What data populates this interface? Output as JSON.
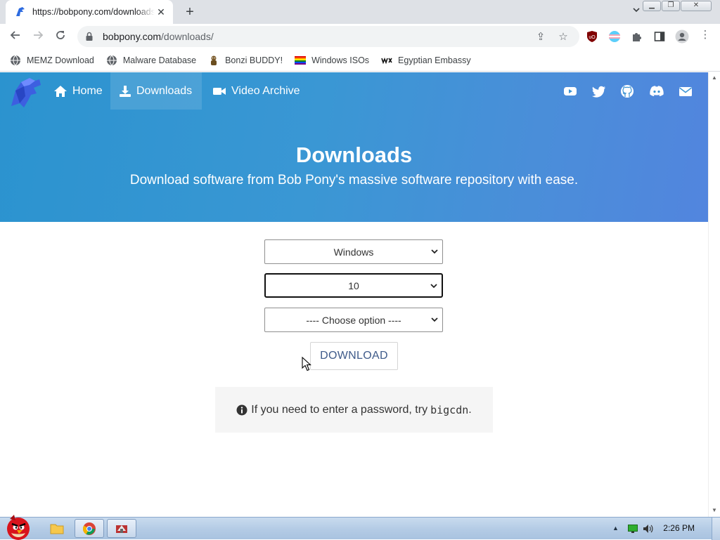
{
  "browser": {
    "tab_title": "https://bobpony.com/downloads/",
    "url_host": "bobpony.com",
    "url_path": "/downloads/",
    "bookmarks": [
      {
        "label": "MEMZ Download",
        "icon": "globe-icon"
      },
      {
        "label": "Malware Database",
        "icon": "globe-icon"
      },
      {
        "label": "Bonzi BUDDY!",
        "icon": "bonzi-icon"
      },
      {
        "label": "Windows ISOs",
        "icon": "rainbow-flag-icon"
      },
      {
        "label": "Egyptian Embassy",
        "icon": "wix-icon"
      }
    ]
  },
  "site": {
    "nav": [
      {
        "label": "Home",
        "icon": "home-icon"
      },
      {
        "label": "Downloads",
        "icon": "download-icon"
      },
      {
        "label": "Video Archive",
        "icon": "video-icon"
      }
    ],
    "social_icons": [
      "youtube-icon",
      "twitter-icon",
      "github-icon",
      "discord-icon",
      "mail-icon"
    ],
    "hero_title": "Downloads",
    "hero_subtitle": "Download software from Bob Pony's massive software repository with ease.",
    "select_os": "Windows",
    "select_version": "10",
    "select_option": "---- Choose option ----",
    "download_label": "DOWNLOAD",
    "note_text": "If you need to enter a password, try",
    "note_code": "bigcdn",
    "note_end": "."
  },
  "taskbar": {
    "clock": "2:26 PM"
  },
  "colors": {
    "hero_start": "#2b93cf",
    "hero_end": "#5285de",
    "download_text": "#3f5b8a"
  }
}
